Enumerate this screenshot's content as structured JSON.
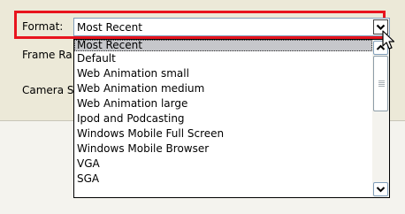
{
  "form": {
    "format_label": "Format:",
    "frame_rate_label": "Frame Ra",
    "camera_label": "Camera S"
  },
  "format_combo": {
    "value": "Most Recent",
    "options": [
      "Most Recent",
      "Default",
      "Web Animation small",
      "Web Animation medium",
      "Web Animation large",
      "Ipod and Podcasting",
      "Windows Mobile Full Screen",
      "Windows Mobile Browser",
      "VGA",
      "SGA"
    ],
    "selected_index": 0
  },
  "icons": {
    "dropdown_arrow": "chevron-down-icon",
    "scroll_up": "chevron-up-icon",
    "scroll_down": "chevron-down-icon",
    "cursor": "mouse-pointer-icon"
  },
  "colors": {
    "highlight_border": "#e8141e",
    "panel_background": "#ece9d8",
    "selected_item_background": "#c6c7cb"
  }
}
